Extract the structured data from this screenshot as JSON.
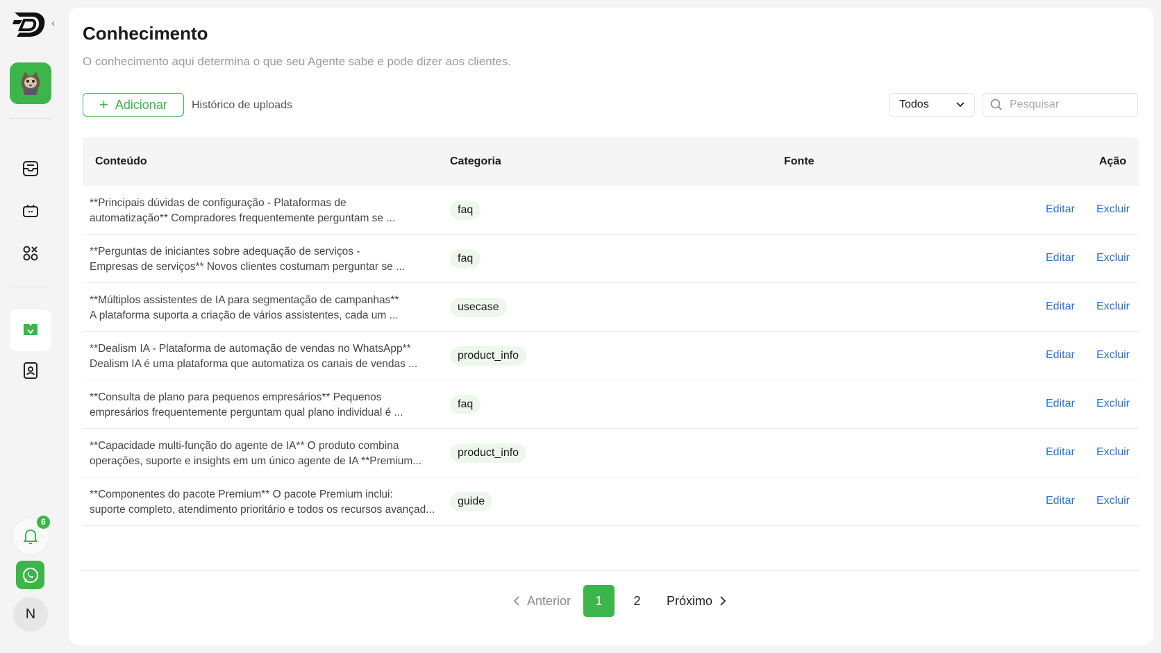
{
  "sidebar": {
    "logo_icon": "dealism-logo",
    "collapse_icon": "chevron-left-icon",
    "agent_avatar_icon": "cat-avatar",
    "nav_items": [
      {
        "icon": "inbox-icon"
      },
      {
        "icon": "bot-icon"
      },
      {
        "icon": "integrations-icon"
      },
      {
        "icon": "knowledge-icon",
        "active": true
      },
      {
        "icon": "contacts-icon"
      }
    ],
    "notifications_count": "6",
    "user_initial": "N",
    "accent": "#3cb54a"
  },
  "header": {
    "title": "Conhecimento",
    "description": "O conhecimento aqui determina o que seu Agente sabe e pode dizer aos clientes."
  },
  "toolbar": {
    "add_label": "Adicionar",
    "history_label": "Histórico de uploads",
    "filter_value": "Todos",
    "search_placeholder": "Pesquisar"
  },
  "table": {
    "columns": {
      "content": "Conteúdo",
      "category": "Categoria",
      "source": "Fonte",
      "action": "Ação"
    },
    "edit_label": "Editar",
    "delete_label": "Excluir",
    "rows": [
      {
        "line1": "**Principais dúvidas de configuração - Plataformas de",
        "line2": "automatização** Compradores frequentemente perguntam se ...",
        "category": "faq"
      },
      {
        "line1": "**Perguntas de iniciantes sobre adequação de serviços -",
        "line2": "Empresas de serviços** Novos clientes costumam perguntar se ...",
        "category": "faq"
      },
      {
        "line1": "**Múltiplos assistentes de IA para segmentação de campanhas**",
        "line2": "A plataforma suporta a criação de vários assistentes, cada um ...",
        "category": "usecase"
      },
      {
        "line1": "**Dealism IA - Plataforma de automação de vendas no WhatsApp**",
        "line2": "Dealism IA é uma plataforma que automatiza os canais de vendas ...",
        "category": "product_info"
      },
      {
        "line1": "**Consulta de plano para pequenos empresários** Pequenos",
        "line2": "empresários frequentemente perguntam qual plano individual é ...",
        "category": "faq"
      },
      {
        "line1": "**Capacidade multi-função do agente de IA** O produto combina",
        "line2": "operações, suporte e insights em um único agente de IA **Premium...",
        "category": "product_info"
      },
      {
        "line1": "**Componentes do pacote Premium** O pacote Premium inclui:",
        "line2": "suporte completo, atendimento prioritário e todos os recursos avançad...",
        "category": "guide"
      }
    ]
  },
  "pagination": {
    "prev_label": "Anterior",
    "next_label": "Próximo",
    "current_page": "1",
    "other_page": "2"
  }
}
